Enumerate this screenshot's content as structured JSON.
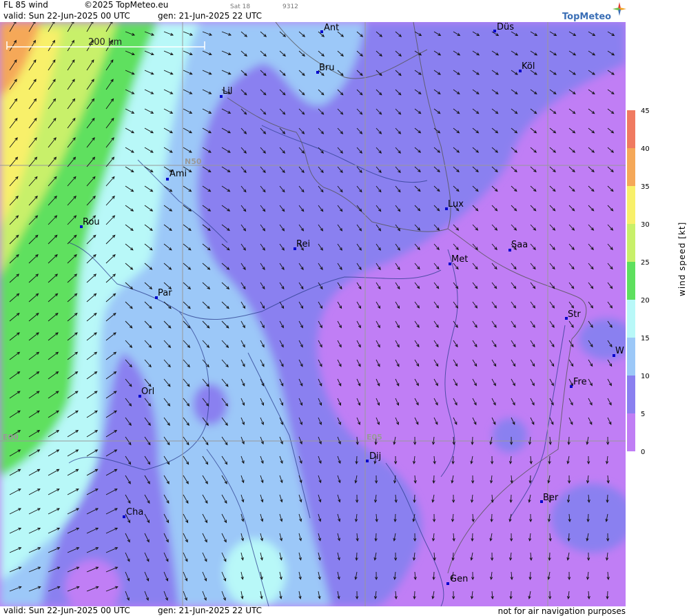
{
  "header": {
    "title": "FL 85 wind",
    "copyright": "©2025 TopMeteo.eu",
    "satellite": "Sat 18",
    "code": "9312",
    "valid": "valid:  Sun  22-Jun-2025  00 UTC",
    "generated": "gen: 21-Jun-2025 22 UTC"
  },
  "footer": {
    "valid": "valid:  Sun  22-Jun-2025  00 UTC",
    "generated": "gen: 21-Jun-2025 22 UTC",
    "disclaimer": "not for air navigation purposes"
  },
  "brand": {
    "name": "TopMeteo"
  },
  "scale_bar": {
    "label": "200 km"
  },
  "grid_labels": {
    "lat": "N50",
    "lon1": "E00",
    "lon2": "E05"
  },
  "cities": [
    {
      "id": "ant",
      "label": "Ant"
    },
    {
      "id": "dus",
      "label": "Düs"
    },
    {
      "id": "bru",
      "label": "Bru"
    },
    {
      "id": "kol",
      "label": "Köl"
    },
    {
      "id": "lil",
      "label": "Lil"
    },
    {
      "id": "ami",
      "label": "Ami"
    },
    {
      "id": "rou",
      "label": "Rou"
    },
    {
      "id": "lux",
      "label": "Lux"
    },
    {
      "id": "rei",
      "label": "Rei"
    },
    {
      "id": "saa",
      "label": "Saa"
    },
    {
      "id": "met",
      "label": "Met"
    },
    {
      "id": "par",
      "label": "Par"
    },
    {
      "id": "str",
      "label": "Str"
    },
    {
      "id": "w",
      "label": "W"
    },
    {
      "id": "fre",
      "label": "Fre"
    },
    {
      "id": "orl",
      "label": "Orl"
    },
    {
      "id": "dij",
      "label": "Dij"
    },
    {
      "id": "ber",
      "label": "Ber"
    },
    {
      "id": "cha",
      "label": "Cha"
    },
    {
      "id": "gen",
      "label": "Gen"
    }
  ],
  "legend": {
    "title": "wind  speed  [kt]",
    "ticks": [
      "45",
      "40",
      "35",
      "30",
      "25",
      "20",
      "15",
      "10",
      "5",
      "0"
    ],
    "colors": [
      "#f07a60",
      "#f5a858",
      "#f8f06a",
      "#c8f06a",
      "#5ee05e",
      "#b8f8f8",
      "#9cc8f8",
      "#8a80f0",
      "#c07ef5"
    ]
  },
  "colors": {
    "violet": "#c07ef5",
    "purple": "#8a80f0",
    "light_blue": "#9cc8f8",
    "cyan": "#b8f8f8",
    "green": "#5ee05e",
    "light_green": "#c8f06a",
    "yellow": "#f8f06a",
    "orange": "#f5a858",
    "city_marker": "#0000cc"
  }
}
